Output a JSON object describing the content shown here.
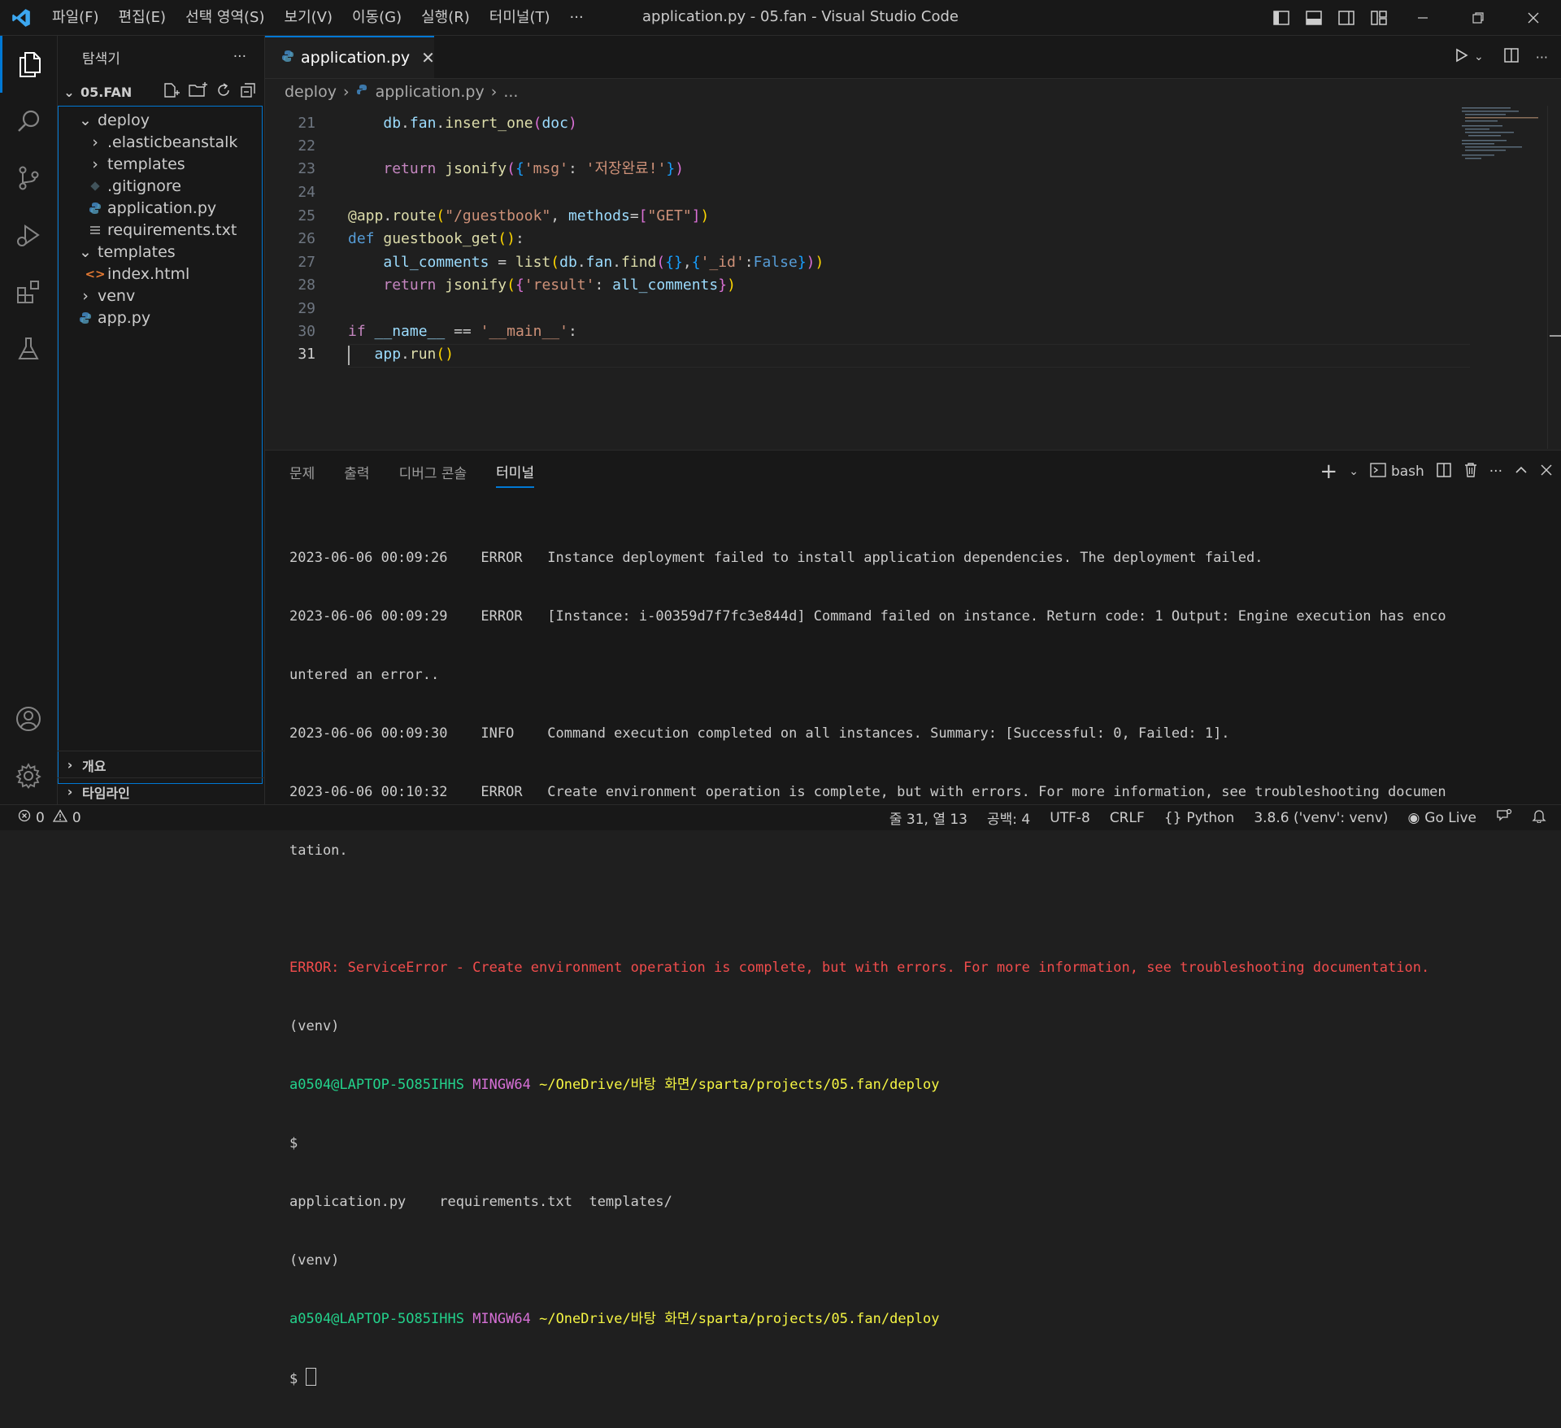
{
  "window": {
    "title": "application.py - 05.fan - Visual Studio Code",
    "menu": [
      "파일(F)",
      "편집(E)",
      "선택 영역(S)",
      "보기(V)",
      "이동(G)",
      "실행(R)",
      "터미널(T)",
      "···"
    ]
  },
  "sidebar": {
    "title": "탐색기",
    "more": "···",
    "folder": "05.FAN",
    "tree": [
      {
        "label": "deploy",
        "type": "folder-open"
      },
      {
        "label": ".elasticbeanstalk",
        "type": "folder-closed"
      },
      {
        "label": "templates",
        "type": "folder-closed"
      },
      {
        "label": ".gitignore",
        "type": "git"
      },
      {
        "label": "application.py",
        "type": "python"
      },
      {
        "label": "requirements.txt",
        "type": "text"
      },
      {
        "label": "templates",
        "type": "folder-open"
      },
      {
        "label": "index.html",
        "type": "html"
      },
      {
        "label": "venv",
        "type": "folder-closed"
      },
      {
        "label": "app.py",
        "type": "python"
      }
    ],
    "outline": "개요",
    "timeline": "타임라인"
  },
  "editor": {
    "tab": "application.py",
    "breadcrumb": [
      "deploy",
      "application.py",
      "..."
    ],
    "lines": [
      {
        "n": "21"
      },
      {
        "n": "22"
      },
      {
        "n": "23"
      },
      {
        "n": "24"
      },
      {
        "n": "25"
      },
      {
        "n": "26"
      },
      {
        "n": "27"
      },
      {
        "n": "28"
      },
      {
        "n": "29"
      },
      {
        "n": "30"
      },
      {
        "n": "31"
      }
    ]
  },
  "panel": {
    "tabs": [
      "문제",
      "출력",
      "디버그 콘솔",
      "터미널"
    ],
    "shell": "bash",
    "terminal": [
      "2023-06-06 00:09:26    ERROR   Instance deployment failed to install application dependencies. The deployment failed.",
      "2023-06-06 00:09:29    ERROR   [Instance: i-00359d7f7fc3e844d] Command failed on instance. Return code: 1 Output: Engine execution has enco",
      "untered an error..",
      "2023-06-06 00:09:30    INFO    Command execution completed on all instances. Summary: [Successful: 0, Failed: 1].",
      "2023-06-06 00:10:32    ERROR   Create environment operation is complete, but with errors. For more information, see troubleshooting documen",
      "tation.",
      "",
      "ERROR: ServiceError - Create environment operation is complete, but with errors. For more information, see troubleshooting documentation.",
      "(venv)",
      "PROMPT1",
      "$",
      "application.py    requirements.txt  templates/",
      "(venv)",
      "PROMPT2",
      "$ "
    ],
    "prompt_user": "a0504@LAPTOP-5O85IHHS",
    "prompt_sys": "MINGW64",
    "prompt_path": "~/OneDrive/바탕 화면/sparta/projects/05.fan/deploy"
  },
  "status": {
    "errors": "0",
    "warnings": "0",
    "position": "줄 31, 열 13",
    "spaces": "공백: 4",
    "encoding": "UTF-8",
    "eol": "CRLF",
    "language": "Python",
    "interpreter": "3.8.6 ('venv': venv)",
    "golive": "Go Live"
  }
}
